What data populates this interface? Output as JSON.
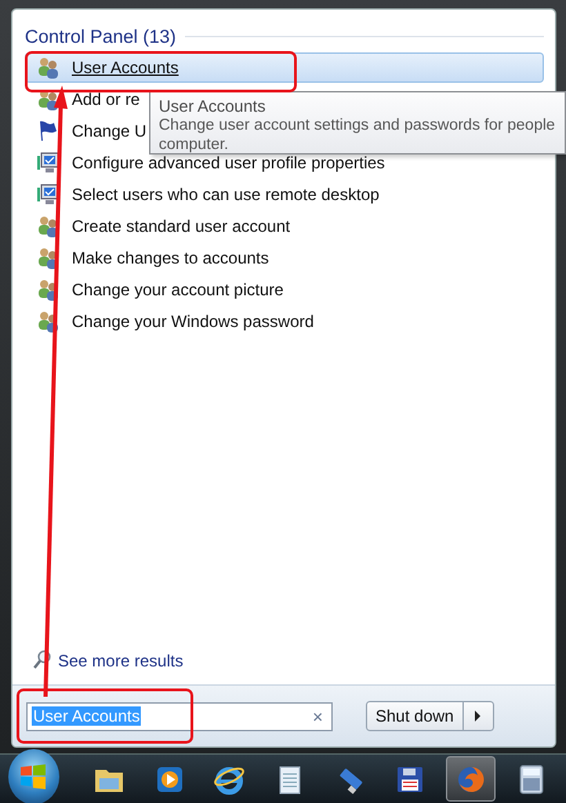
{
  "results": {
    "group_title": "Control Panel (13)",
    "items": [
      {
        "label": "User Accounts",
        "kind": "users",
        "selected": true
      },
      {
        "label": "Add or re",
        "kind": "users",
        "selected": false
      },
      {
        "label": "Change U",
        "kind": "flag",
        "selected": false
      },
      {
        "label": "Configure advanced user profile properties",
        "kind": "monitor",
        "selected": false
      },
      {
        "label": "Select users who can use remote desktop",
        "kind": "monitor",
        "selected": false
      },
      {
        "label": "Create standard user account",
        "kind": "users",
        "selected": false
      },
      {
        "label": "Make changes to accounts",
        "kind": "users",
        "selected": false
      },
      {
        "label": "Change your account picture",
        "kind": "users",
        "selected": false
      },
      {
        "label": "Change your Windows password",
        "kind": "users",
        "selected": false
      }
    ]
  },
  "tooltip": {
    "title": "User Accounts",
    "lines": [
      "Change user account settings and passwords for people",
      "computer."
    ]
  },
  "see_more": "See more results",
  "search": {
    "value": "User Accounts",
    "clear": "×"
  },
  "shutdown": {
    "label": "Shut down"
  },
  "taskbar": {
    "items": [
      {
        "kind": "folder",
        "selected": false
      },
      {
        "kind": "media",
        "selected": false
      },
      {
        "kind": "browser",
        "selected": false
      },
      {
        "kind": "notepad",
        "selected": false
      },
      {
        "kind": "usb",
        "selected": false
      },
      {
        "kind": "floppy",
        "selected": false
      },
      {
        "kind": "firefox",
        "selected": true
      },
      {
        "kind": "calculator",
        "selected": false
      }
    ]
  }
}
